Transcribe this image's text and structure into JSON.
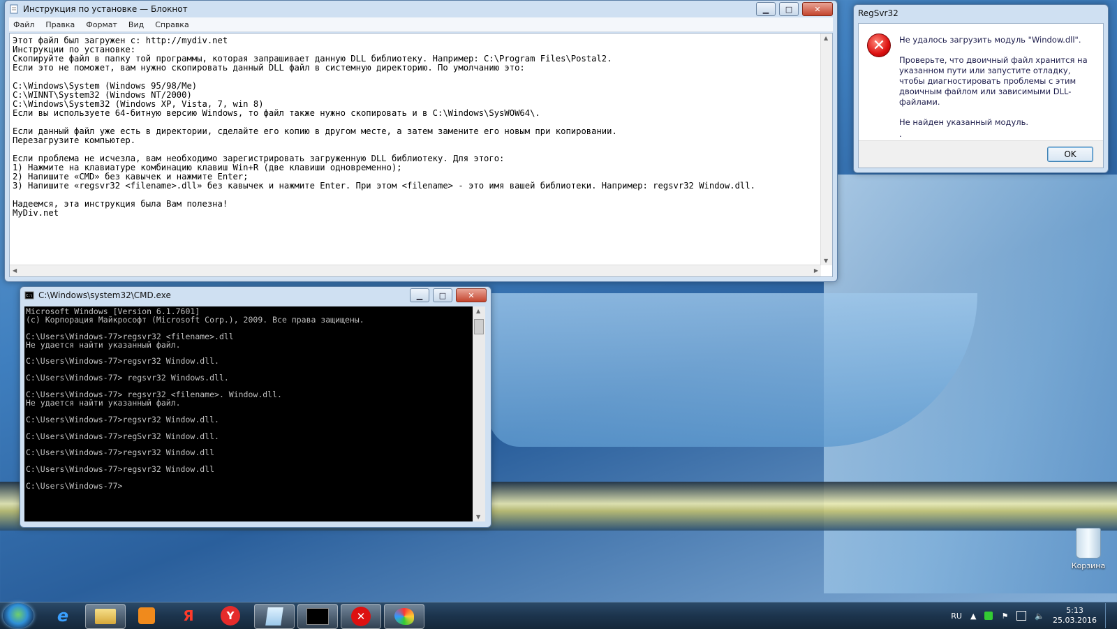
{
  "notepad": {
    "title": "Инструкция по установке — Блокнот",
    "menu": [
      "Файл",
      "Правка",
      "Формат",
      "Вид",
      "Справка"
    ],
    "text": "Этот файл был загружен с: http://mydiv.net\nИнструкции по установке:\nСкопируйте файл в папку той программы, которая запрашивает данную DLL библиотеку. Например: C:\\Program Files\\Postal2.\nЕсли это не поможет, вам нужно скопировать данный DLL файл в системную директорию. По умолчанию это:\n\nC:\\Windows\\System (Windows 95/98/Me)\nC:\\WINNT\\System32 (Windows NT/2000)\nC:\\Windows\\System32 (Windows XP, Vista, 7, win 8)\nЕсли вы используете 64-битную версию Windows, то файл также нужно скопировать и в C:\\Windows\\SysWOW64\\.\n\nЕсли данный файл уже есть в директории, сделайте его копию в другом месте, а затем замените его новым при копировании.\nПерезагрузите компьютер.\n\nЕсли проблема не исчезла, вам необходимо зарегистрировать загруженную DLL библиотеку. Для этого:\n1) Нажмите на клавиатуре комбинацию клавиш Win+R (две клавиши одновременно);\n2) Напишите «CMD» без кавычек и нажмите Enter;\n3) Напишите «regsvr32 <filename>.dll» без кавычек и нажмите Enter. При этом <filename> - это имя вашей библиотеки. Например: regsvr32 Window.dll.\n\nНадеемся, эта инструкция была Вам полезна!\nMyDiv.net"
  },
  "dialog": {
    "title": "RegSvr32",
    "message1": "Не удалось загрузить модуль \"Window.dll\".",
    "message2": "Проверьте, что двоичный файл хранится на указанном пути или запустите отладку, чтобы диагностировать проблемы с этим двоичным файлом или зависимыми DLL-файлами.",
    "message3": "Не найден указанный модуль.",
    "message4": ".",
    "ok_label": "OK"
  },
  "cmd": {
    "title": "C:\\Windows\\system32\\CMD.exe",
    "text": "Microsoft Windows [Version 6.1.7601]\n(c) Корпорация Майкрософт (Microsoft Corp.), 2009. Все права защищены.\n\nC:\\Users\\Windows-77>regsvr32 <filename>.dll\nНе удается найти указанный файл.\n\nC:\\Users\\Windows-77>regsvr32 Window.dll.\n\nC:\\Users\\Windows-77> regsvr32 Windows.dll.\n\nC:\\Users\\Windows-77> regsvr32 <filename>. Window.dll.\nНе удается найти указанный файл.\n\nC:\\Users\\Windows-77>regsvr32 Window.dll.\n\nC:\\Users\\Windows-77>regSvr32 Window.dll.\n\nC:\\Users\\Windows-77>regsvr32 Window.dll\n\nC:\\Users\\Windows-77>regsvr32 Window.dll\n\nC:\\Users\\Windows-77>"
  },
  "desktop": {
    "recycle_bin_label": "Корзина"
  },
  "taskbar": {
    "items": [
      "internet-explorer-icon",
      "explorer-folder-icon",
      "media-player-icon",
      "yandex-icon",
      "yandex-browser-icon",
      "notepad-icon",
      "cmd-icon",
      "regsvr-error-icon",
      "paint-icon"
    ],
    "language": "RU",
    "time": "5:13",
    "date": "25.03.2016"
  },
  "colors": {
    "error_red": "#d11111",
    "taskbar": "#1c344d",
    "cmd_bg": "#000000",
    "cmd_fg": "#c0c0c0"
  }
}
